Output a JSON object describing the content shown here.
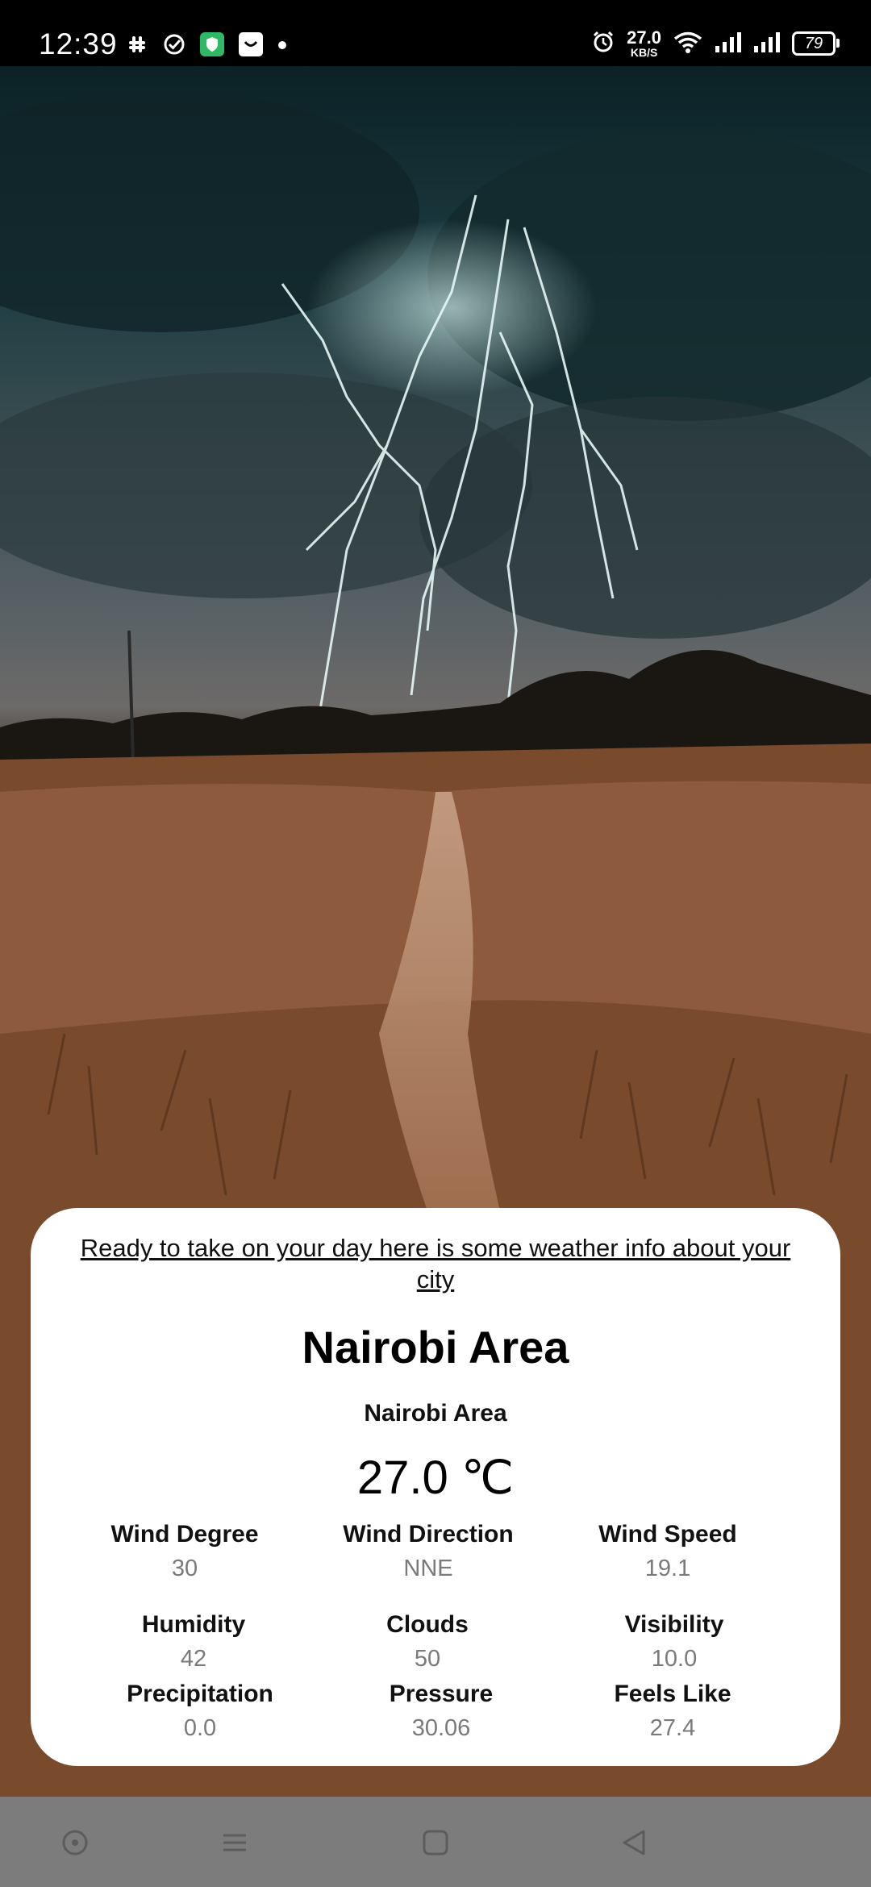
{
  "status_bar": {
    "time": "12:39",
    "net_speed_value": "27.0",
    "net_speed_unit": "KB/S",
    "battery": "79",
    "icons": [
      "slack-icon",
      "check-circle-icon",
      "shield-icon",
      "smile-bag-icon",
      "dot-icon",
      "alarm-icon",
      "wifi-icon",
      "signal-icon",
      "signal-icon",
      "battery-icon"
    ]
  },
  "card": {
    "tagline": "Ready to take on your day here is some weather info about your city",
    "city_title": "Nairobi Area",
    "city_subtitle": "Nairobi Area",
    "temperature": "27.0 ℃",
    "stats": {
      "wind_degree": {
        "label": "Wind Degree",
        "value": "30"
      },
      "wind_direction": {
        "label": "Wind Direction",
        "value": "NNE"
      },
      "wind_speed": {
        "label": "Wind Speed",
        "value": "19.1"
      },
      "humidity": {
        "label": "Humidity",
        "value": "42"
      },
      "clouds": {
        "label": "Clouds",
        "value": "50"
      },
      "visibility": {
        "label": "Visibility",
        "value": "10.0"
      },
      "precipitation": {
        "label": "Precipitation",
        "value": "0.0"
      },
      "pressure": {
        "label": "Pressure",
        "value": "30.06"
      },
      "feels_like": {
        "label": "Feels Like",
        "value": "27.4"
      }
    }
  },
  "nav_bar": {
    "buttons": [
      "assistant-icon",
      "menu-icon",
      "home-icon",
      "back-icon"
    ]
  },
  "colors": {
    "card_bg": "#ffffff",
    "value_gray": "#7a7a7a",
    "nav_bar": "#7c7c7c",
    "status_bar": "#000000"
  }
}
